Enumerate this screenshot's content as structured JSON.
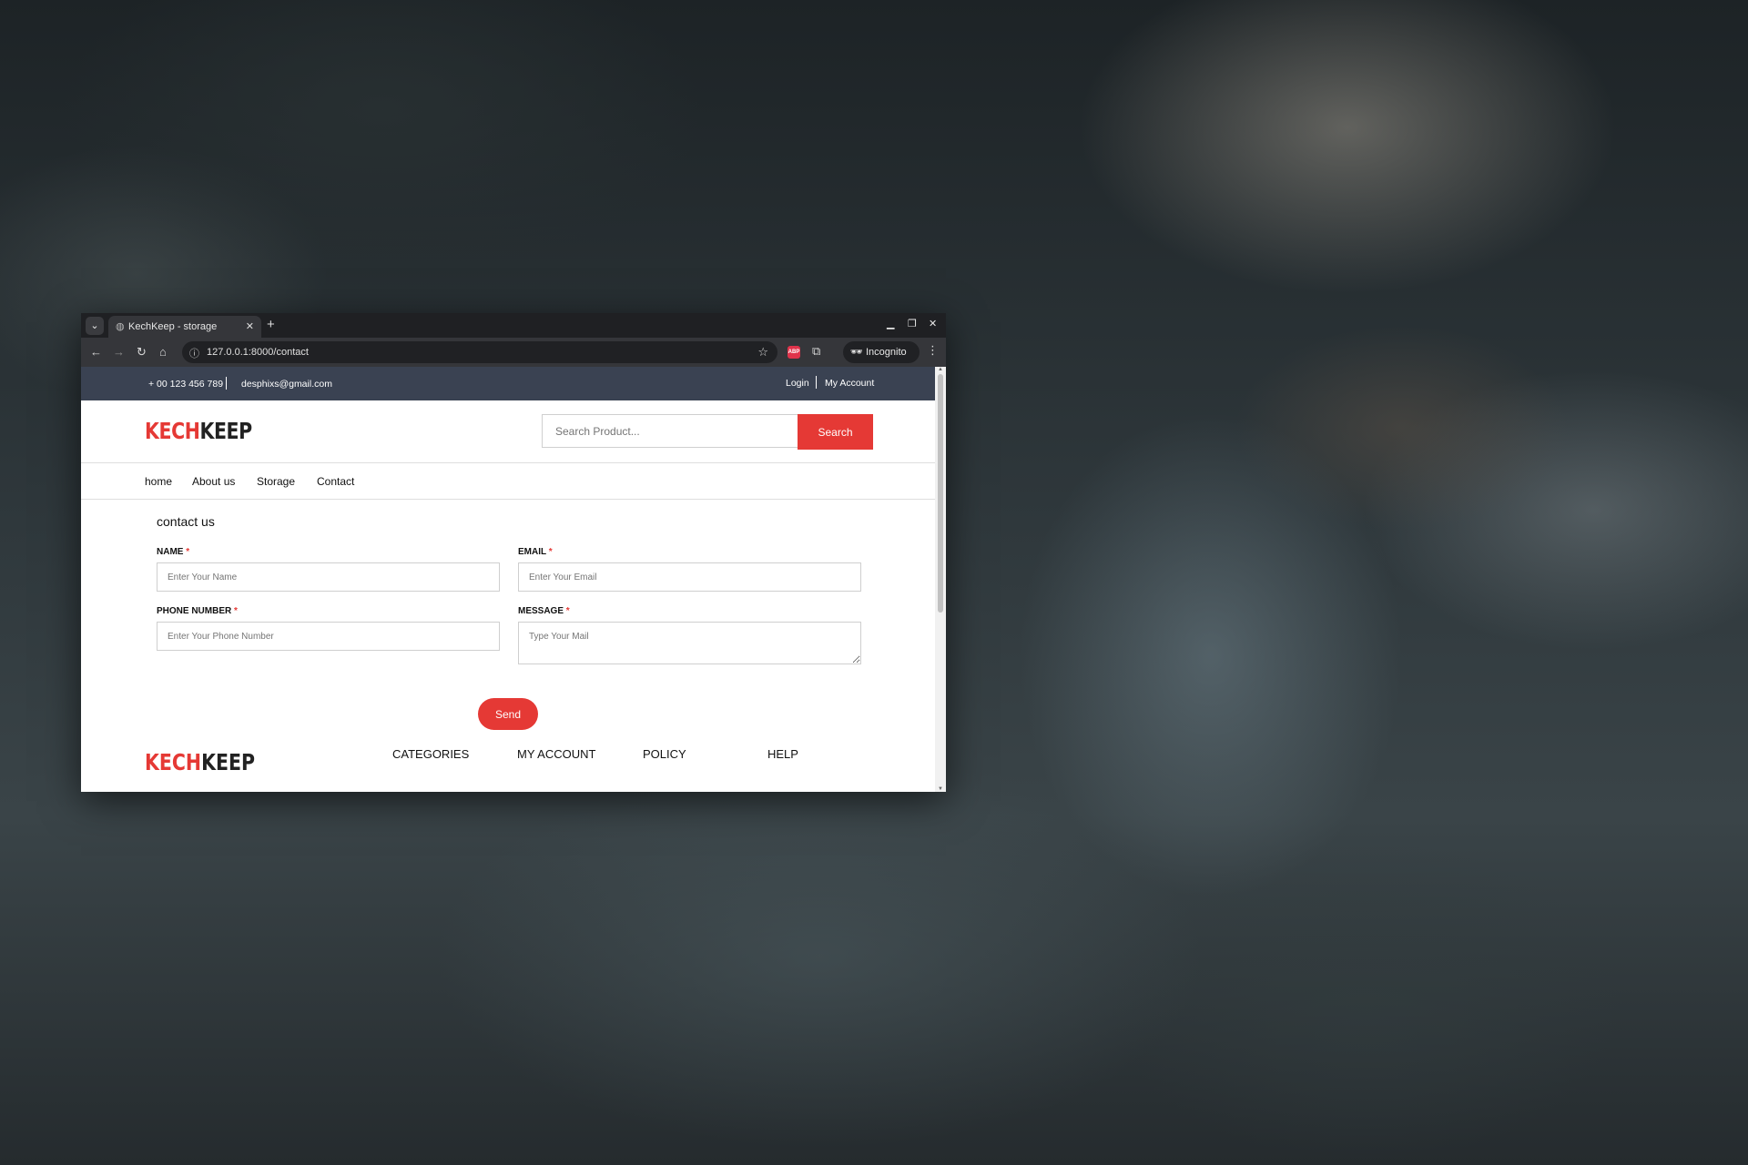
{
  "browser": {
    "tab_title": "KechKeep - storage",
    "new_tab": "+",
    "url": "127.0.0.1:8000/contact",
    "incognito_label": "Incognito",
    "ext_abp": "ABP"
  },
  "topbar": {
    "phone": "+ 00 123 456 789",
    "email": "desphixs@gmail.com",
    "login": "Login",
    "account": "My Account"
  },
  "header": {
    "logo_part1": "KECH",
    "logo_part2": "KEEP",
    "search_placeholder": "Search Product...",
    "search_button": "Search"
  },
  "nav": {
    "items": [
      "home",
      "About us",
      "Storage",
      "Contact"
    ]
  },
  "contact": {
    "title": "contact us",
    "required_mark": "*",
    "name_label": "NAME",
    "name_placeholder": "Enter Your Name",
    "email_label": "EMAIL",
    "email_placeholder": "Enter Your Email",
    "phone_label": "PHONE NUMBER",
    "phone_placeholder": "Enter Your Phone Number",
    "message_label": "MESSAGE",
    "message_placeholder": "Type Your Mail",
    "send_button": "Send"
  },
  "footer": {
    "columns": [
      "CATEGORIES",
      "MY ACCOUNT",
      "POLICY",
      "HELP"
    ]
  },
  "colors": {
    "accent": "#e53935",
    "topbar": "#3a4252"
  }
}
